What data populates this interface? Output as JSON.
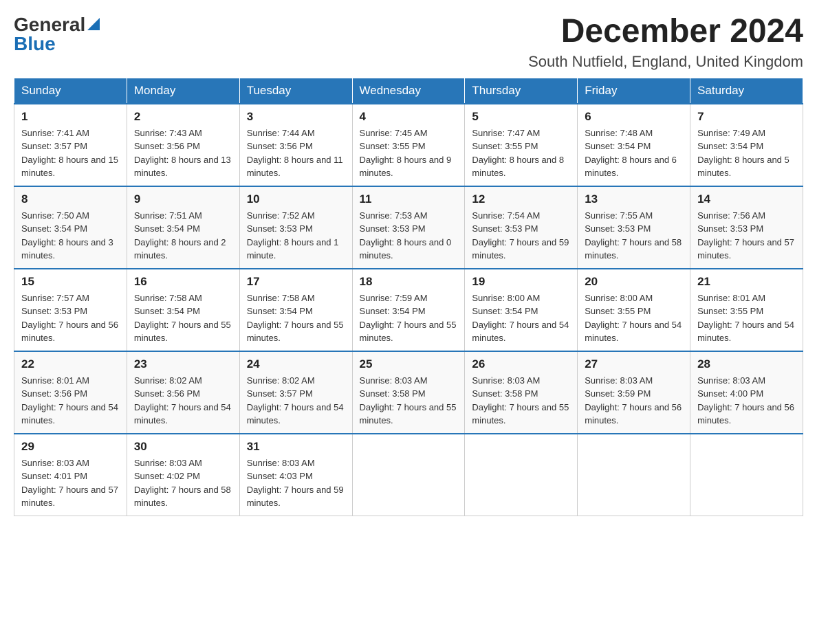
{
  "logo": {
    "general": "General",
    "blue": "Blue"
  },
  "title": {
    "month": "December 2024",
    "location": "South Nutfield, England, United Kingdom"
  },
  "days_header": [
    "Sunday",
    "Monday",
    "Tuesday",
    "Wednesday",
    "Thursday",
    "Friday",
    "Saturday"
  ],
  "weeks": [
    [
      {
        "day": "1",
        "sunrise": "7:41 AM",
        "sunset": "3:57 PM",
        "daylight": "8 hours and 15 minutes."
      },
      {
        "day": "2",
        "sunrise": "7:43 AM",
        "sunset": "3:56 PM",
        "daylight": "8 hours and 13 minutes."
      },
      {
        "day": "3",
        "sunrise": "7:44 AM",
        "sunset": "3:56 PM",
        "daylight": "8 hours and 11 minutes."
      },
      {
        "day": "4",
        "sunrise": "7:45 AM",
        "sunset": "3:55 PM",
        "daylight": "8 hours and 9 minutes."
      },
      {
        "day": "5",
        "sunrise": "7:47 AM",
        "sunset": "3:55 PM",
        "daylight": "8 hours and 8 minutes."
      },
      {
        "day": "6",
        "sunrise": "7:48 AM",
        "sunset": "3:54 PM",
        "daylight": "8 hours and 6 minutes."
      },
      {
        "day": "7",
        "sunrise": "7:49 AM",
        "sunset": "3:54 PM",
        "daylight": "8 hours and 5 minutes."
      }
    ],
    [
      {
        "day": "8",
        "sunrise": "7:50 AM",
        "sunset": "3:54 PM",
        "daylight": "8 hours and 3 minutes."
      },
      {
        "day": "9",
        "sunrise": "7:51 AM",
        "sunset": "3:54 PM",
        "daylight": "8 hours and 2 minutes."
      },
      {
        "day": "10",
        "sunrise": "7:52 AM",
        "sunset": "3:53 PM",
        "daylight": "8 hours and 1 minute."
      },
      {
        "day": "11",
        "sunrise": "7:53 AM",
        "sunset": "3:53 PM",
        "daylight": "8 hours and 0 minutes."
      },
      {
        "day": "12",
        "sunrise": "7:54 AM",
        "sunset": "3:53 PM",
        "daylight": "7 hours and 59 minutes."
      },
      {
        "day": "13",
        "sunrise": "7:55 AM",
        "sunset": "3:53 PM",
        "daylight": "7 hours and 58 minutes."
      },
      {
        "day": "14",
        "sunrise": "7:56 AM",
        "sunset": "3:53 PM",
        "daylight": "7 hours and 57 minutes."
      }
    ],
    [
      {
        "day": "15",
        "sunrise": "7:57 AM",
        "sunset": "3:53 PM",
        "daylight": "7 hours and 56 minutes."
      },
      {
        "day": "16",
        "sunrise": "7:58 AM",
        "sunset": "3:54 PM",
        "daylight": "7 hours and 55 minutes."
      },
      {
        "day": "17",
        "sunrise": "7:58 AM",
        "sunset": "3:54 PM",
        "daylight": "7 hours and 55 minutes."
      },
      {
        "day": "18",
        "sunrise": "7:59 AM",
        "sunset": "3:54 PM",
        "daylight": "7 hours and 55 minutes."
      },
      {
        "day": "19",
        "sunrise": "8:00 AM",
        "sunset": "3:54 PM",
        "daylight": "7 hours and 54 minutes."
      },
      {
        "day": "20",
        "sunrise": "8:00 AM",
        "sunset": "3:55 PM",
        "daylight": "7 hours and 54 minutes."
      },
      {
        "day": "21",
        "sunrise": "8:01 AM",
        "sunset": "3:55 PM",
        "daylight": "7 hours and 54 minutes."
      }
    ],
    [
      {
        "day": "22",
        "sunrise": "8:01 AM",
        "sunset": "3:56 PM",
        "daylight": "7 hours and 54 minutes."
      },
      {
        "day": "23",
        "sunrise": "8:02 AM",
        "sunset": "3:56 PM",
        "daylight": "7 hours and 54 minutes."
      },
      {
        "day": "24",
        "sunrise": "8:02 AM",
        "sunset": "3:57 PM",
        "daylight": "7 hours and 54 minutes."
      },
      {
        "day": "25",
        "sunrise": "8:03 AM",
        "sunset": "3:58 PM",
        "daylight": "7 hours and 55 minutes."
      },
      {
        "day": "26",
        "sunrise": "8:03 AM",
        "sunset": "3:58 PM",
        "daylight": "7 hours and 55 minutes."
      },
      {
        "day": "27",
        "sunrise": "8:03 AM",
        "sunset": "3:59 PM",
        "daylight": "7 hours and 56 minutes."
      },
      {
        "day": "28",
        "sunrise": "8:03 AM",
        "sunset": "4:00 PM",
        "daylight": "7 hours and 56 minutes."
      }
    ],
    [
      {
        "day": "29",
        "sunrise": "8:03 AM",
        "sunset": "4:01 PM",
        "daylight": "7 hours and 57 minutes."
      },
      {
        "day": "30",
        "sunrise": "8:03 AM",
        "sunset": "4:02 PM",
        "daylight": "7 hours and 58 minutes."
      },
      {
        "day": "31",
        "sunrise": "8:03 AM",
        "sunset": "4:03 PM",
        "daylight": "7 hours and 59 minutes."
      },
      null,
      null,
      null,
      null
    ]
  ],
  "labels": {
    "sunrise": "Sunrise:",
    "sunset": "Sunset:",
    "daylight": "Daylight:"
  }
}
